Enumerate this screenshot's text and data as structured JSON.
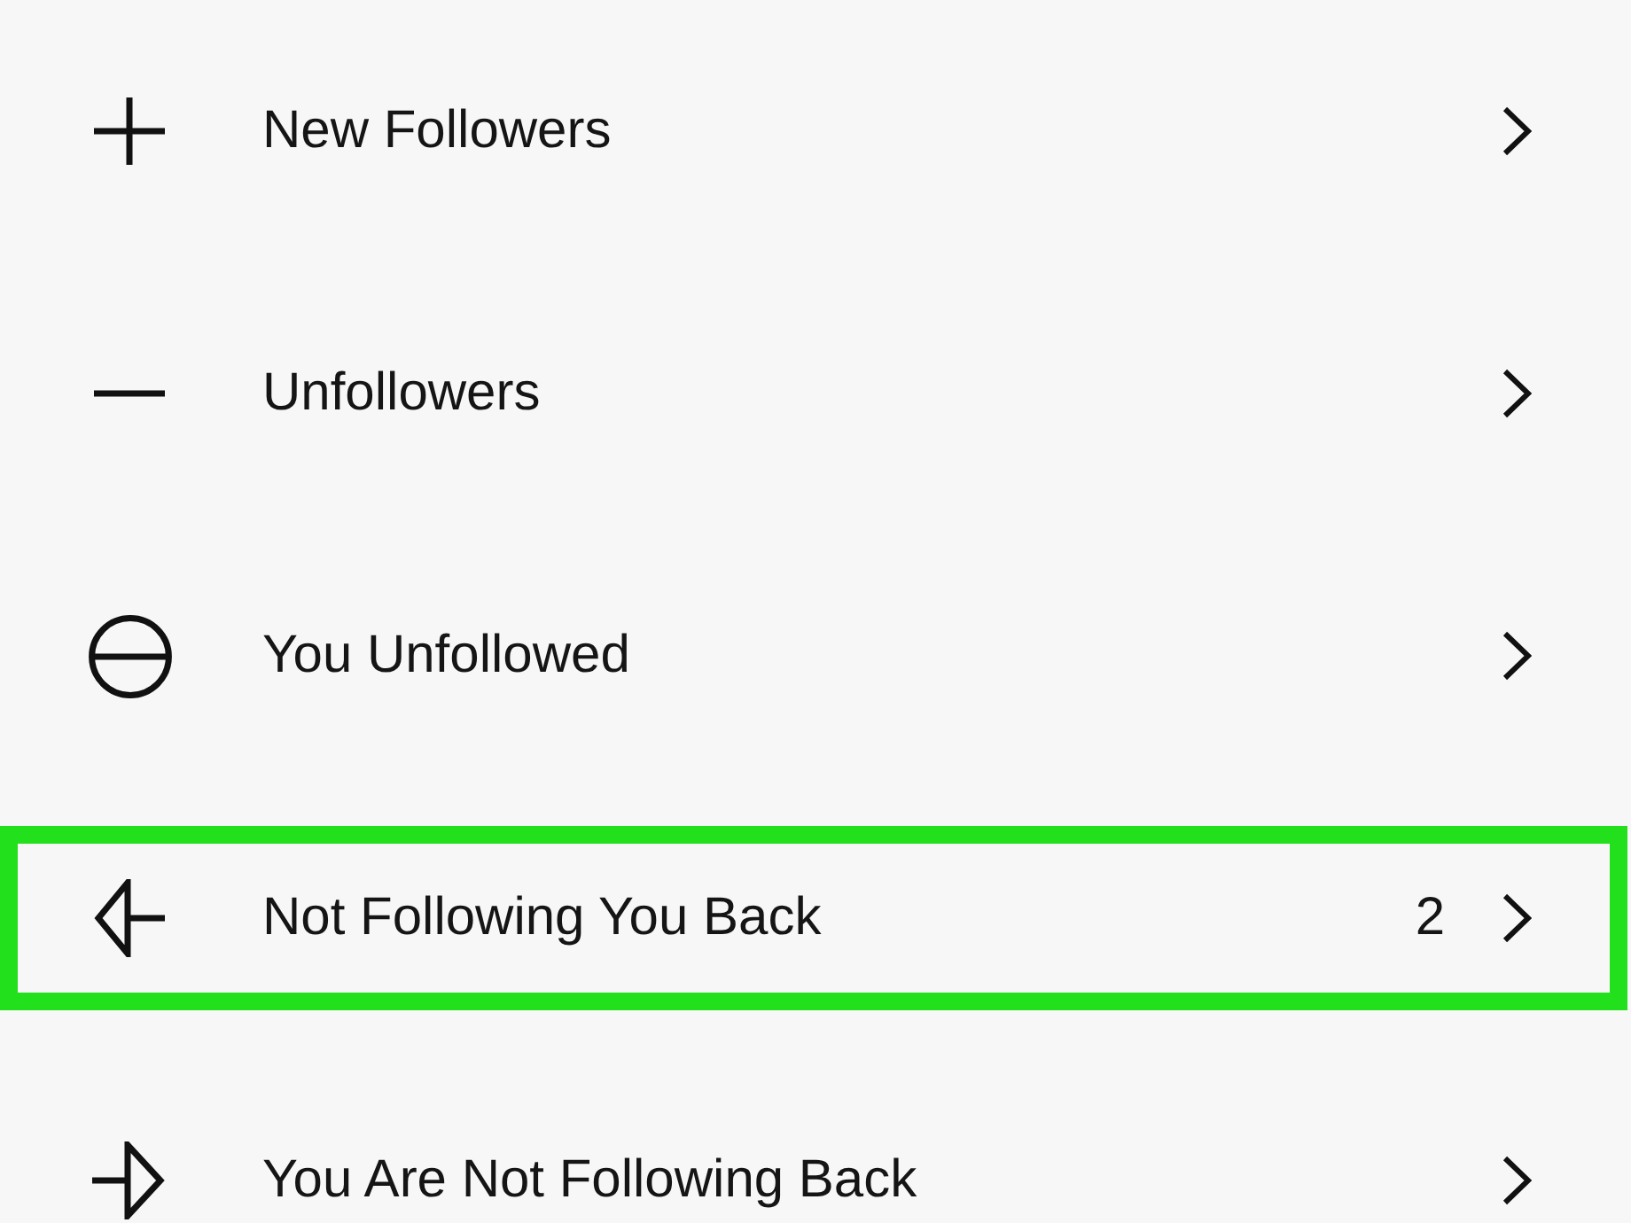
{
  "rows": [
    {
      "kind": "plus",
      "label": "New Followers",
      "highlighted": false
    },
    {
      "kind": "minus",
      "label": "Unfollowers",
      "highlighted": false
    },
    {
      "kind": "circle",
      "label": "You Unfollowed",
      "highlighted": false
    },
    {
      "kind": "left",
      "label": "Not Following You Back",
      "count": "2",
      "highlighted": true
    },
    {
      "kind": "right",
      "label": "You Are Not Following Back",
      "highlighted": false
    }
  ]
}
